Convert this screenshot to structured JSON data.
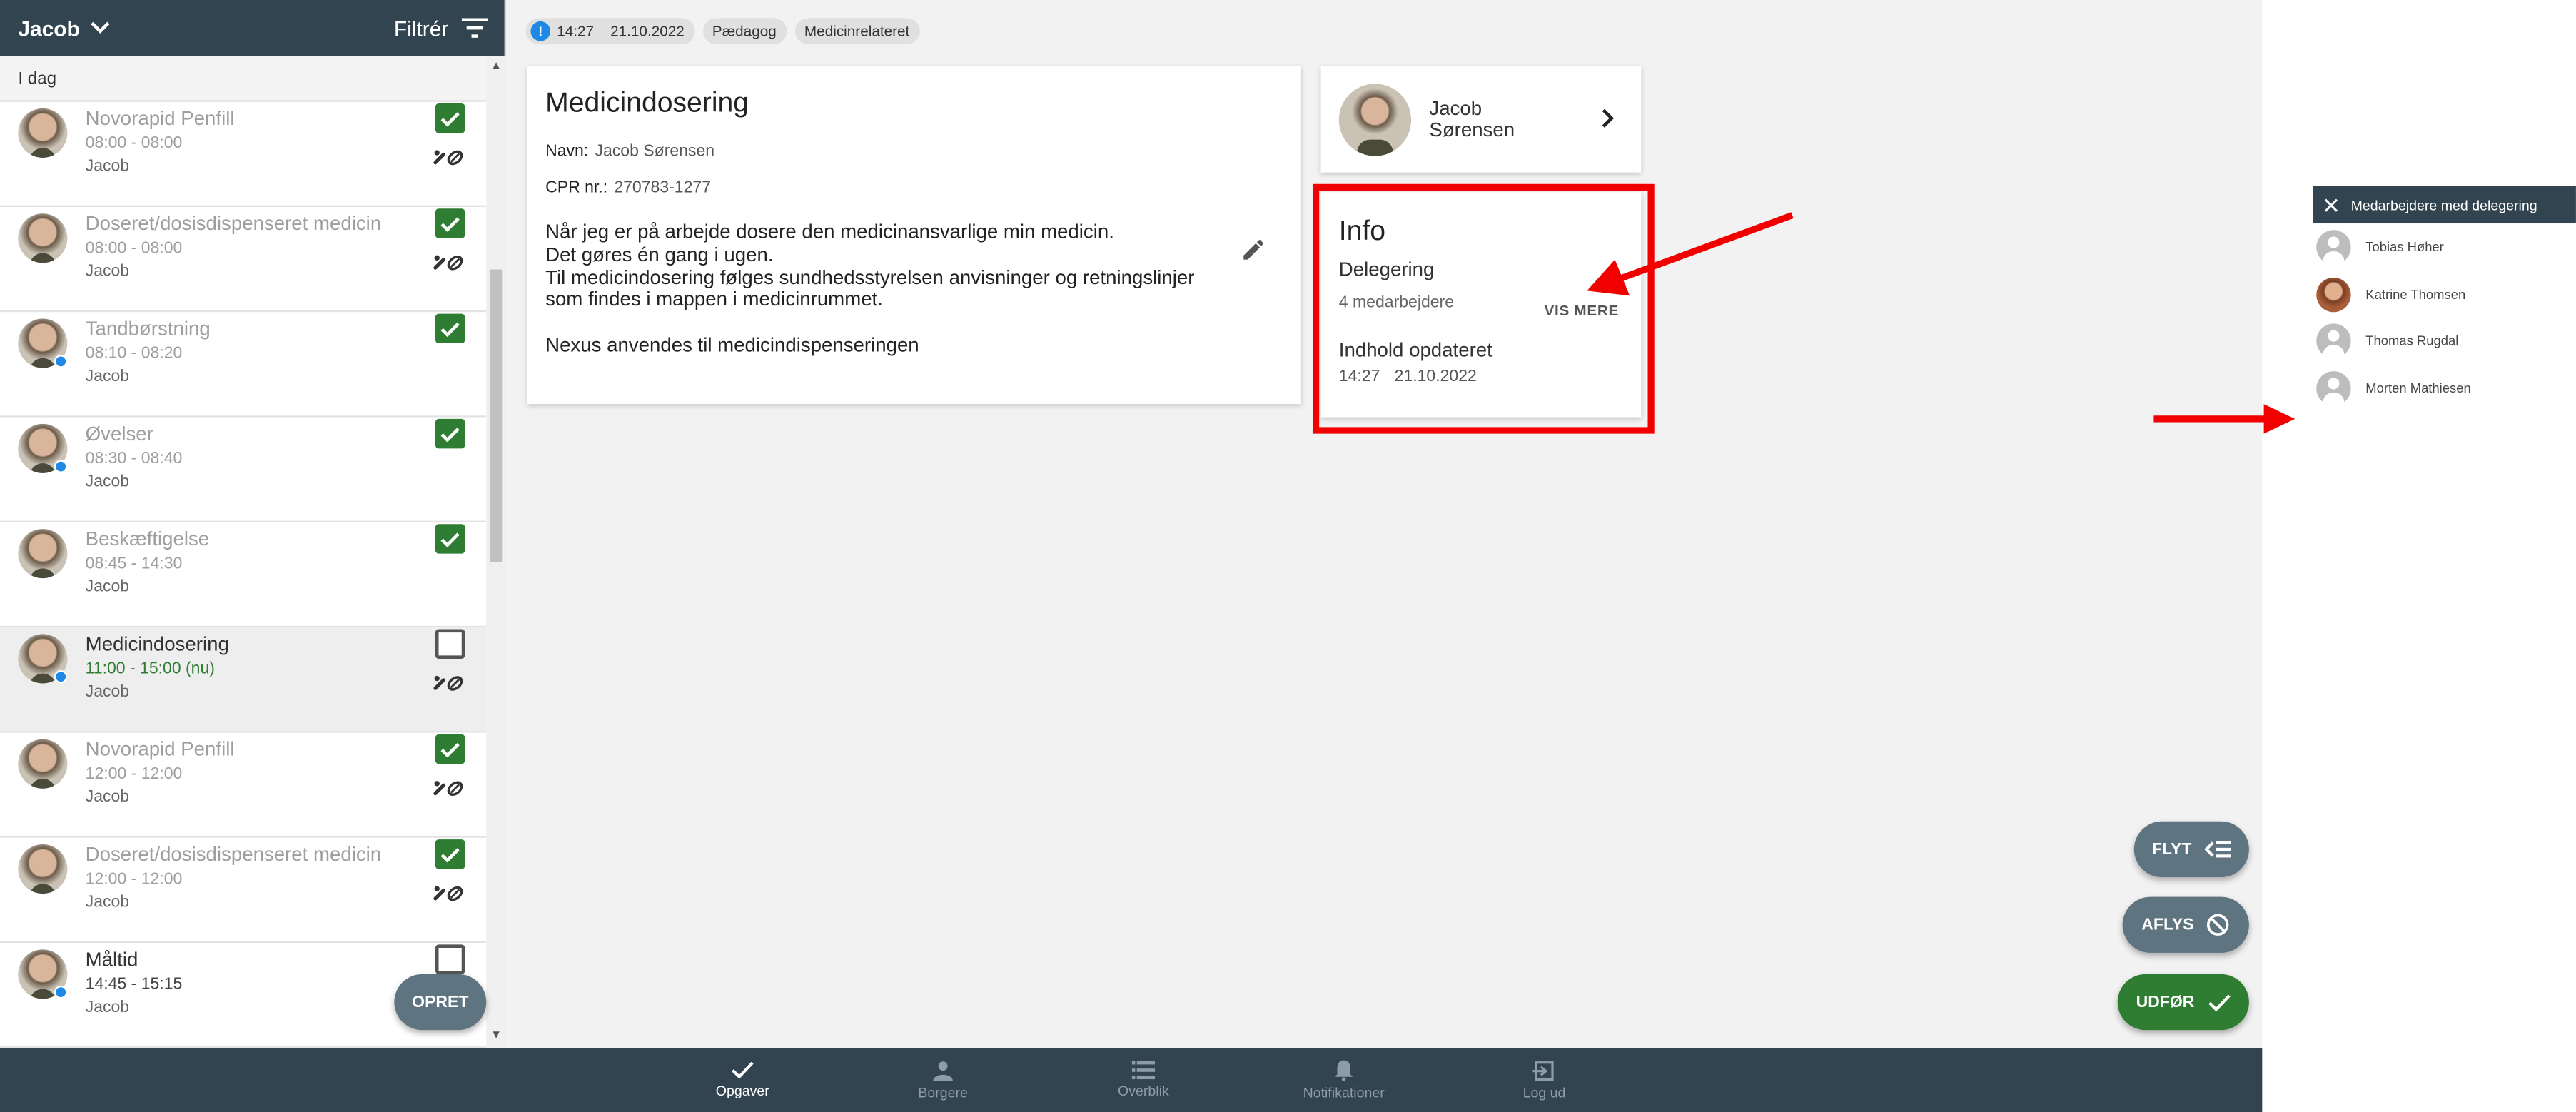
{
  "header": {
    "user_name": "Jacob",
    "filter_label": "Filtrér"
  },
  "section_label": "I dag",
  "tasks": [
    {
      "title": "Novorapid Penfill",
      "time": "08:00 - 08:00",
      "person": "Jacob",
      "done": true,
      "medicine": true,
      "dot": false
    },
    {
      "title": "Doseret/dosisdispenseret medicin",
      "time": "08:00 - 08:00",
      "person": "Jacob",
      "done": true,
      "medicine": true,
      "dot": false
    },
    {
      "title": "Tandbørstning",
      "time": "08:10 - 08:20",
      "person": "Jacob",
      "done": true,
      "medicine": false,
      "dot": true
    },
    {
      "title": "Øvelser",
      "time": "08:30 - 08:40",
      "person": "Jacob",
      "done": true,
      "medicine": false,
      "dot": true
    },
    {
      "title": "Beskæftigelse",
      "time": "08:45 - 14:30",
      "person": "Jacob",
      "done": true,
      "medicine": false,
      "dot": false
    },
    {
      "title": "Medicindosering",
      "time": "11:00 - 15:00 (nu)",
      "person": "Jacob",
      "done": false,
      "medicine": true,
      "dot": true
    },
    {
      "title": "Novorapid Penfill",
      "time": "12:00 - 12:00",
      "person": "Jacob",
      "done": true,
      "medicine": true,
      "dot": false
    },
    {
      "title": "Doseret/dosisdispenseret medicin",
      "time": "12:00 - 12:00",
      "person": "Jacob",
      "done": true,
      "medicine": true,
      "dot": false
    },
    {
      "title": "Måltid",
      "time": "14:45 - 15:15",
      "person": "Jacob",
      "done": false,
      "medicine": false,
      "dot": true
    }
  ],
  "opret_label": "OPRET",
  "tags": {
    "time": "14:27",
    "date": "21.10.2022",
    "tag1": "Pædagog",
    "tag2": "Medicinrelateret",
    "alert": "!"
  },
  "main": {
    "title": "Medicindosering",
    "name_label": "Navn:",
    "name_value": "Jacob Sørensen",
    "cpr_label": "CPR nr.:",
    "cpr_value": "270783-1277",
    "desc_line1": "Når jeg er på arbejde dosere den medicinansvarlige min medicin.",
    "desc_line2": "Det gøres én gang i ugen.",
    "desc_line3": "Til medicindosering følges sundhedsstyrelsen anvisninger og retningslinjer",
    "desc_line4": "som findes i mappen i medicinrummet.",
    "desc_line5": "Nexus anvendes til medicindispenseringen"
  },
  "person": {
    "first": "Jacob",
    "last": "Sørensen"
  },
  "info": {
    "title": "Info",
    "delegation": "Delegering",
    "count": "4 medarbejdere",
    "vis_mere": "VIS MERE",
    "updated_label": "Indhold opdateret",
    "updated_time": "14:27",
    "updated_date": "21.10.2022"
  },
  "actions": {
    "flyt": "FLYT",
    "aflys": "AFLYS",
    "udfor": "UDFØR"
  },
  "nav": {
    "opgaver": "Opgaver",
    "borgere": "Borgere",
    "overblik": "Overblik",
    "notifikationer": "Notifikationer",
    "logud": "Log ud"
  },
  "side_panel": {
    "title": "Medarbejdere med delegering",
    "people": [
      "Tobias Høher",
      "Katrine Thomsen",
      "Thomas Rugdal",
      "Morten Mathiesen"
    ]
  },
  "colors": {
    "header": "#32444f",
    "accent_green": "#2e7d32",
    "button_gray": "#5e7481",
    "highlight_red": "#f20000",
    "dot_blue": "#1e88e5"
  }
}
